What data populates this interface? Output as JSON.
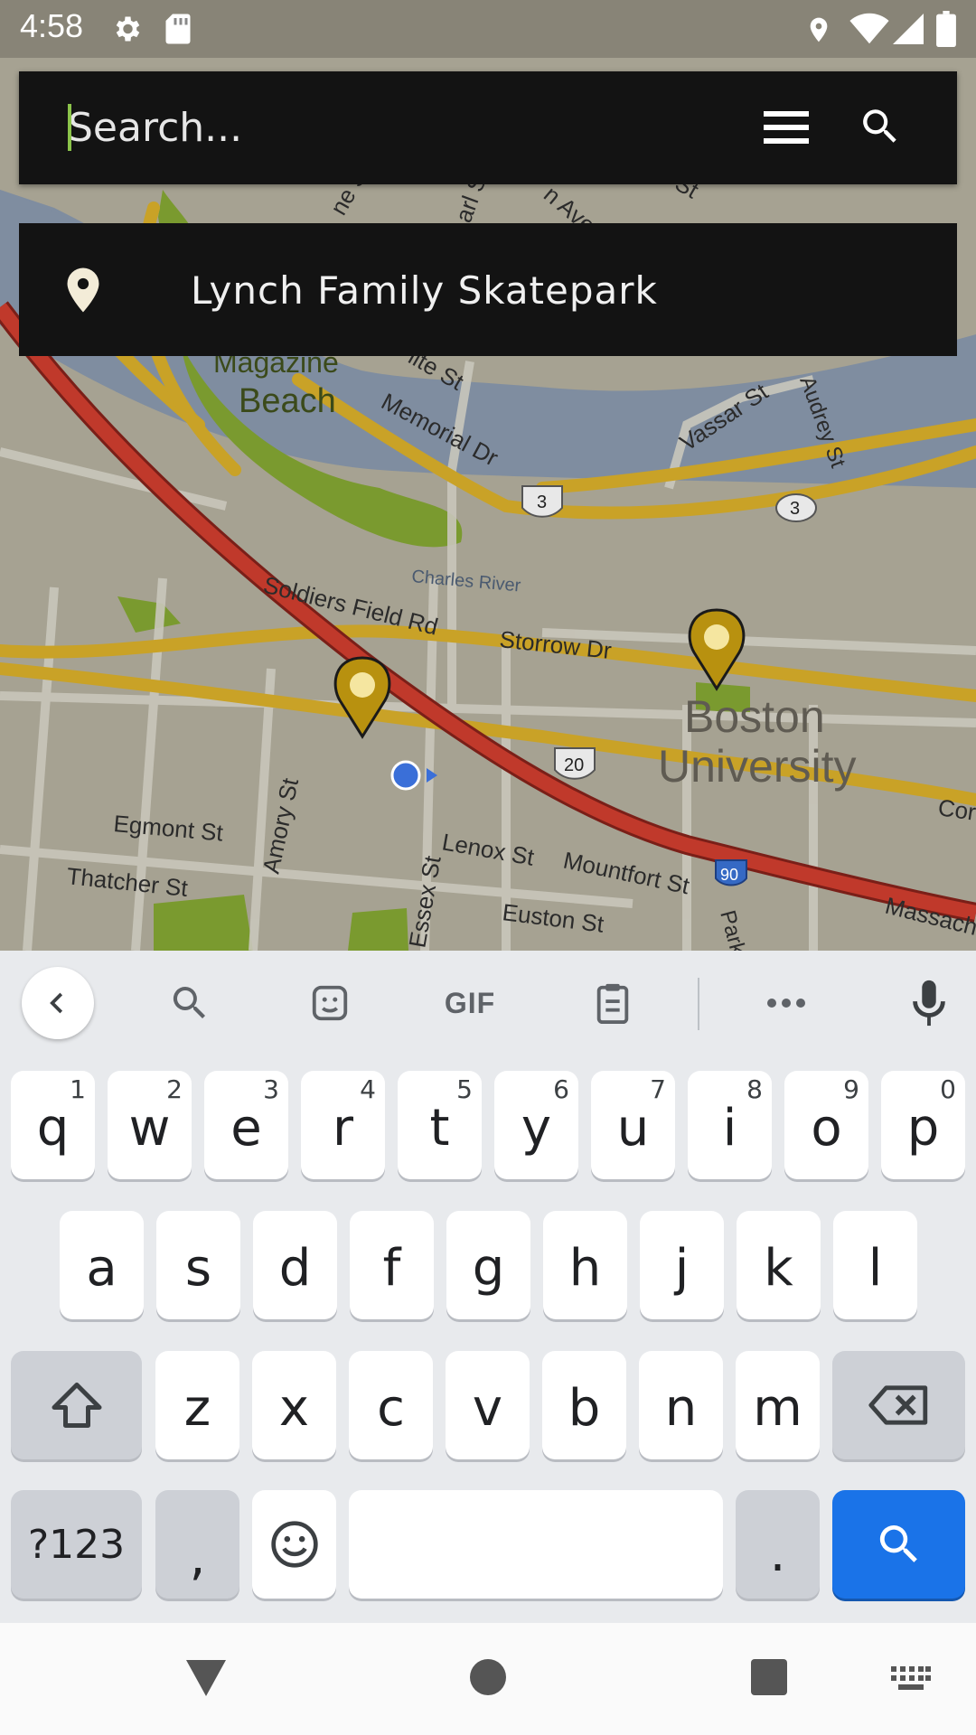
{
  "status_bar": {
    "time": "4:58",
    "icons": [
      "gear-icon",
      "sd-card-icon",
      "location-icon",
      "wifi-icon",
      "signal-icon",
      "battery-icon"
    ]
  },
  "search": {
    "placeholder": "Search...",
    "value": "",
    "menu_icon": "menu-icon",
    "search_icon": "search-icon"
  },
  "suggestion": {
    "icon": "location-pin-icon",
    "label": "Lynch Family Skatepark"
  },
  "map": {
    "labels": {
      "magazine": "Magazine",
      "beach": "Beach",
      "memorial_dr": "Memorial Dr",
      "lite_st": "lite St",
      "vassar_st": "Vassar St",
      "audrey_st": "Audrey St",
      "charles_river": "Charles River",
      "soldiers_field_rd": "Soldiers Field Rd",
      "storrow_dr": "Storrow Dr",
      "boston": "Boston",
      "university": "University",
      "egmont_st": "Egmont St",
      "amory_st": "Amory St",
      "thatcher_st": "Thatcher St",
      "lenox_st": "Lenox St",
      "mountfort_st": "Mountfort St",
      "essex_st": "Essex St",
      "euston_st": "Euston St",
      "massach": "Massach",
      "cor": "Cor",
      "park": "Park",
      "ave": "n Ave",
      "st_top": "St",
      "arl_st": "arl St",
      "ne_st": "ne St",
      "route_3a": "3",
      "route_3b": "3",
      "route_20": "20",
      "route_90": "90"
    },
    "colors": {
      "land": "#a39f8f",
      "water": "#7d8c9e",
      "park": "#7a9a2f",
      "highway": "#c0392b",
      "arterial": "#c9a227",
      "pin": "#b8910f"
    }
  },
  "keyboard": {
    "toolbar": [
      "back-arrow-icon",
      "search-icon",
      "sticker-icon",
      "gif-label",
      "clipboard-icon",
      "more-icon",
      "microphone-icon"
    ],
    "gif_label": "GIF",
    "row1": [
      {
        "k": "q",
        "h": "1"
      },
      {
        "k": "w",
        "h": "2"
      },
      {
        "k": "e",
        "h": "3"
      },
      {
        "k": "r",
        "h": "4"
      },
      {
        "k": "t",
        "h": "5"
      },
      {
        "k": "y",
        "h": "6"
      },
      {
        "k": "u",
        "h": "7"
      },
      {
        "k": "i",
        "h": "8"
      },
      {
        "k": "o",
        "h": "9"
      },
      {
        "k": "p",
        "h": "0"
      }
    ],
    "row2": [
      "a",
      "s",
      "d",
      "f",
      "g",
      "h",
      "j",
      "k",
      "l"
    ],
    "row3": [
      "z",
      "x",
      "c",
      "v",
      "b",
      "n",
      "m"
    ],
    "symbols_label": "?123",
    "comma": ",",
    "period": ".",
    "action_color": "#1a73e8"
  },
  "nav_bar": {
    "icons": [
      "back-triangle-icon",
      "home-circle-icon",
      "recents-square-icon",
      "keyboard-switch-icon"
    ]
  }
}
